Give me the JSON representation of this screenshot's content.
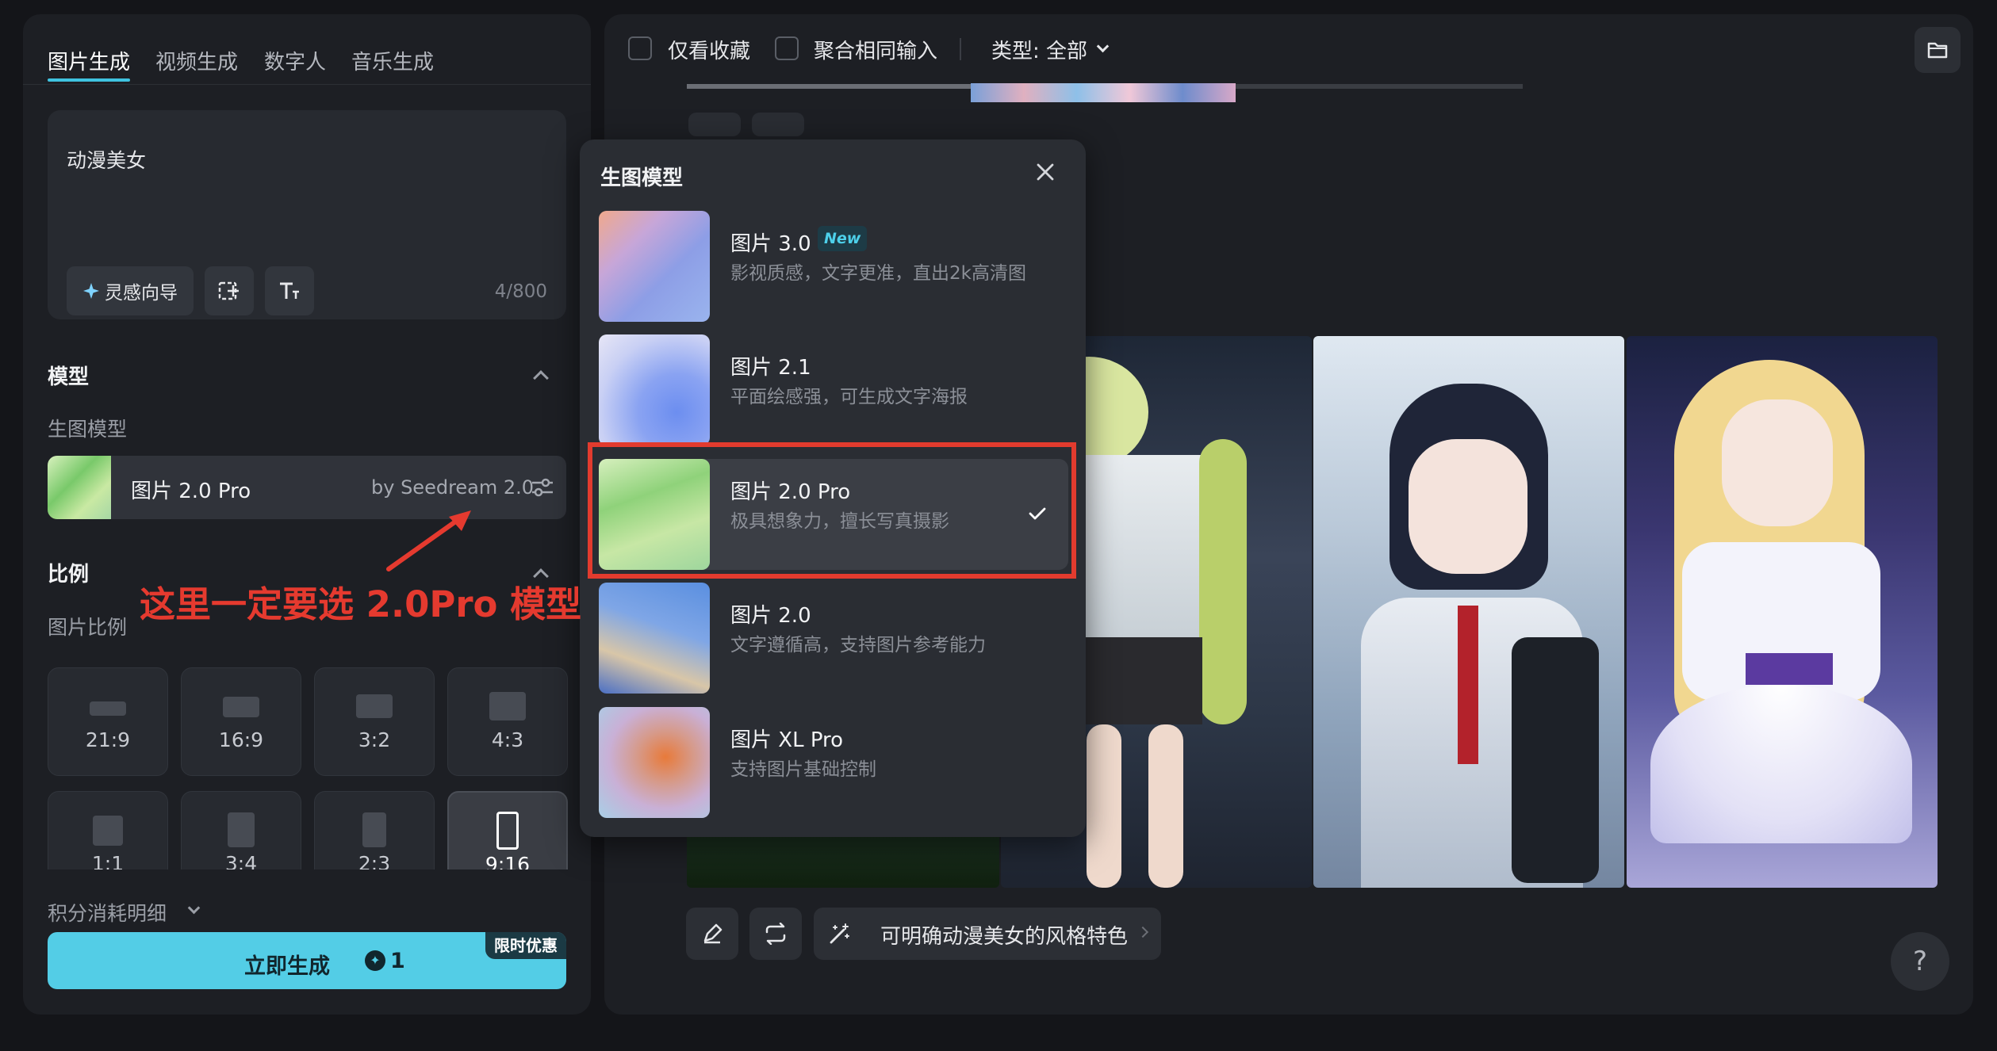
{
  "tabs": [
    "图片生成",
    "视频生成",
    "数字人",
    "音乐生成"
  ],
  "prompt": {
    "text": "动漫美女",
    "inspiration_label": "灵感向导",
    "char_count": "4/800"
  },
  "model_section": {
    "title": "模型",
    "subtitle": "生图模型",
    "selected_name": "图片 2.0 Pro",
    "selected_by": "by Seedream 2.0"
  },
  "ratio_section": {
    "title": "比例",
    "subtitle": "图片比例",
    "ratios": [
      "21:9",
      "16:9",
      "3:2",
      "4:3",
      "1:1",
      "3:4",
      "2:3",
      "9:16"
    ],
    "selected": "9:16"
  },
  "credits_label": "积分消耗明细",
  "generate": {
    "label": "立即生成",
    "cost": "1",
    "promo": "限时优惠"
  },
  "toolbar": {
    "favorites_only": "仅看收藏",
    "merge_same_input": "聚合相同输入",
    "type_filter": "类型: 全部"
  },
  "suggestion": "可明确动漫美女的风格特色",
  "help_label": "?",
  "dropdown": {
    "title": "生图模型",
    "items": [
      {
        "name": "图片 3.0",
        "badge": "New",
        "desc": "影视质感，文字更准，直出2k高清图"
      },
      {
        "name": "图片 2.1",
        "badge": "",
        "desc": "平面绘感强，可生成文字海报"
      },
      {
        "name": "图片 2.0 Pro",
        "badge": "",
        "desc": "极具想象力，擅长写真摄影"
      },
      {
        "name": "图片 2.0",
        "badge": "",
        "desc": "文字遵循高，支持图片参考能力"
      },
      {
        "name": "图片 XL Pro",
        "badge": "",
        "desc": "支持图片基础控制"
      }
    ],
    "selected_index": 2
  },
  "annotation": "这里一定要选 2.0Pro 模型",
  "colors": {
    "accent": "#53cde6",
    "annotation_red": "#e23b2e",
    "panel_bg": "#1d1f24"
  }
}
